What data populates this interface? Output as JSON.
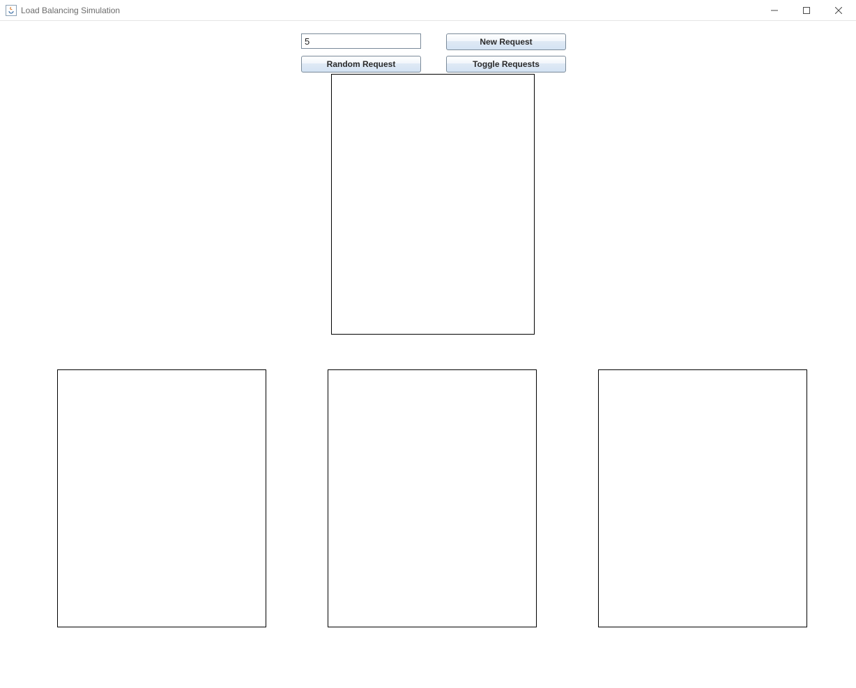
{
  "window": {
    "title": "Load Balancing Simulation"
  },
  "controls": {
    "input_value": "5",
    "new_request_label": "New Request",
    "random_request_label": "Random Request",
    "toggle_requests_label": "Toggle Requests"
  }
}
